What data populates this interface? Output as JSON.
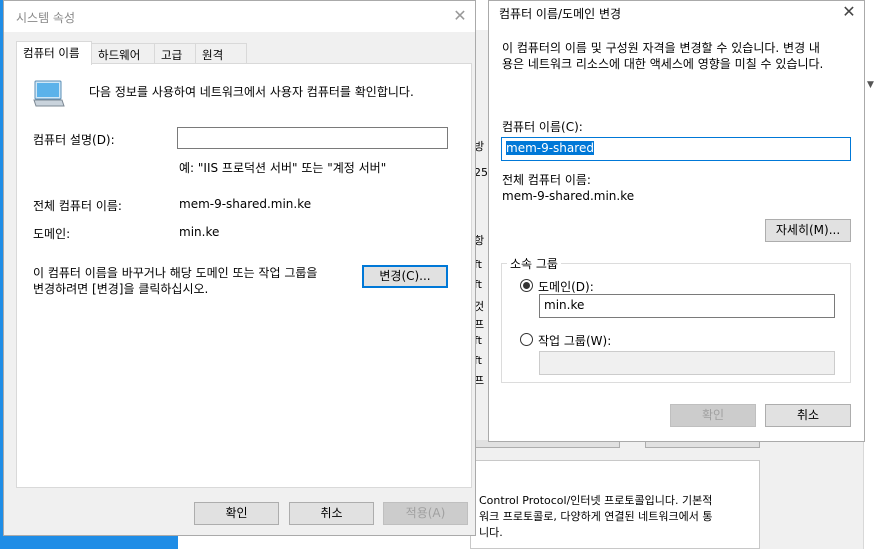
{
  "background": {
    "side_fragments": [
      "방",
      "25",
      "항",
      "ft",
      "ft",
      "것",
      "프",
      "ft",
      "ft",
      "프"
    ],
    "description_lines": [
      "Control Protocol/인터넷 프로토콜입니다. 기본적",
      "워크 프로토콜로, 다양하게 연결된 네트워크에서 통",
      "니다."
    ]
  },
  "system_properties": {
    "title": "시스템 속성",
    "tabs": [
      {
        "label": "컴퓨터 이름"
      },
      {
        "label": "하드웨어"
      },
      {
        "label": "고급"
      },
      {
        "label": "원격"
      }
    ],
    "intro": "다음 정보를 사용하여 네트워크에서 사용자 컴퓨터를 확인합니다.",
    "description_label": "컴퓨터 설명(D):",
    "description_value": "",
    "example": "예: \"IIS 프로덕션 서버\" 또는 \"계정 서버\"",
    "full_name_label": "전체 컴퓨터 이름:",
    "full_name_value": "mem-9-shared.min.ke",
    "domain_label": "도메인:",
    "domain_value": "min.ke",
    "rename_text_line1": "이 컴퓨터 이름을 바꾸거나 해당 도메인 또는 작업 그룹을",
    "rename_text_line2": "변경하려면 [변경]을 클릭하십시오.",
    "change_button": "변경(C)...",
    "ok_button": "확인",
    "cancel_button": "취소",
    "apply_button": "적용(A)"
  },
  "rename_dialog": {
    "title": "컴퓨터 이름/도메인 변경",
    "intro_line1": "이 컴퓨터의 이름 및 구성원 자격을 변경할 수 있습니다. 변경 내",
    "intro_line2": "용은 네트워크 리소스에 대한 액세스에 영향을 미칠 수 있습니다.",
    "computer_name_label": "컴퓨터 이름(C):",
    "computer_name_value": "mem-9-shared",
    "full_name_label": "전체 컴퓨터 이름:",
    "full_name_value": "mem-9-shared.min.ke",
    "more_button": "자세히(M)...",
    "member_of_label": "소속 그룹",
    "domain_radio_label": "도메인(D):",
    "domain_value": "min.ke",
    "workgroup_radio_label": "작업 그룹(W):",
    "workgroup_value": "",
    "selected": "domain",
    "ok_button": "확인",
    "cancel_button": "취소"
  },
  "colors": {
    "desktop": "#1f8de6",
    "selection": "#0078d7"
  }
}
